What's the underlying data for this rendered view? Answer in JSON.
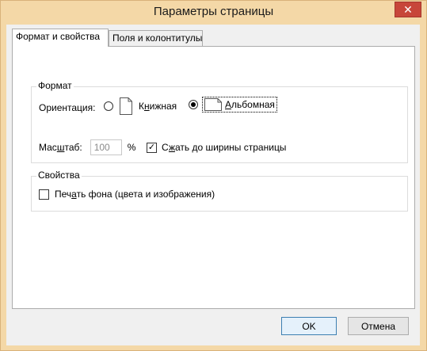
{
  "window": {
    "title": "Параметры страницы",
    "close_glyph": "✕"
  },
  "tabs": [
    {
      "label": "Формат и свойства",
      "active": true
    },
    {
      "label": "Поля и колонтитулы",
      "active": false
    }
  ],
  "format_group": {
    "legend": "Формат",
    "orientation": {
      "label": "Ориентация:",
      "portrait": {
        "before": "К",
        "accel": "н",
        "after": "ижная",
        "selected": false
      },
      "landscape": {
        "before": "",
        "accel": "А",
        "after": "льбомная",
        "selected": true
      }
    },
    "scale": {
      "label_before": "Мас",
      "label_accel": "ш",
      "label_after": "таб:",
      "value": "100",
      "unit": "%"
    },
    "shrink": {
      "before": "С",
      "accel": "ж",
      "after": "ать до ширины страницы",
      "checked": true
    }
  },
  "properties_group": {
    "legend": "Свойства",
    "print_background": {
      "before": "Печ",
      "accel": "а",
      "after": "ть фона (цвета и изображения)",
      "checked": false
    }
  },
  "buttons": {
    "ok": "OK",
    "cancel": "Отмена"
  },
  "icons": {
    "portrait": "page-portrait-icon",
    "landscape": "page-landscape-icon",
    "check": "checkmark-icon"
  }
}
